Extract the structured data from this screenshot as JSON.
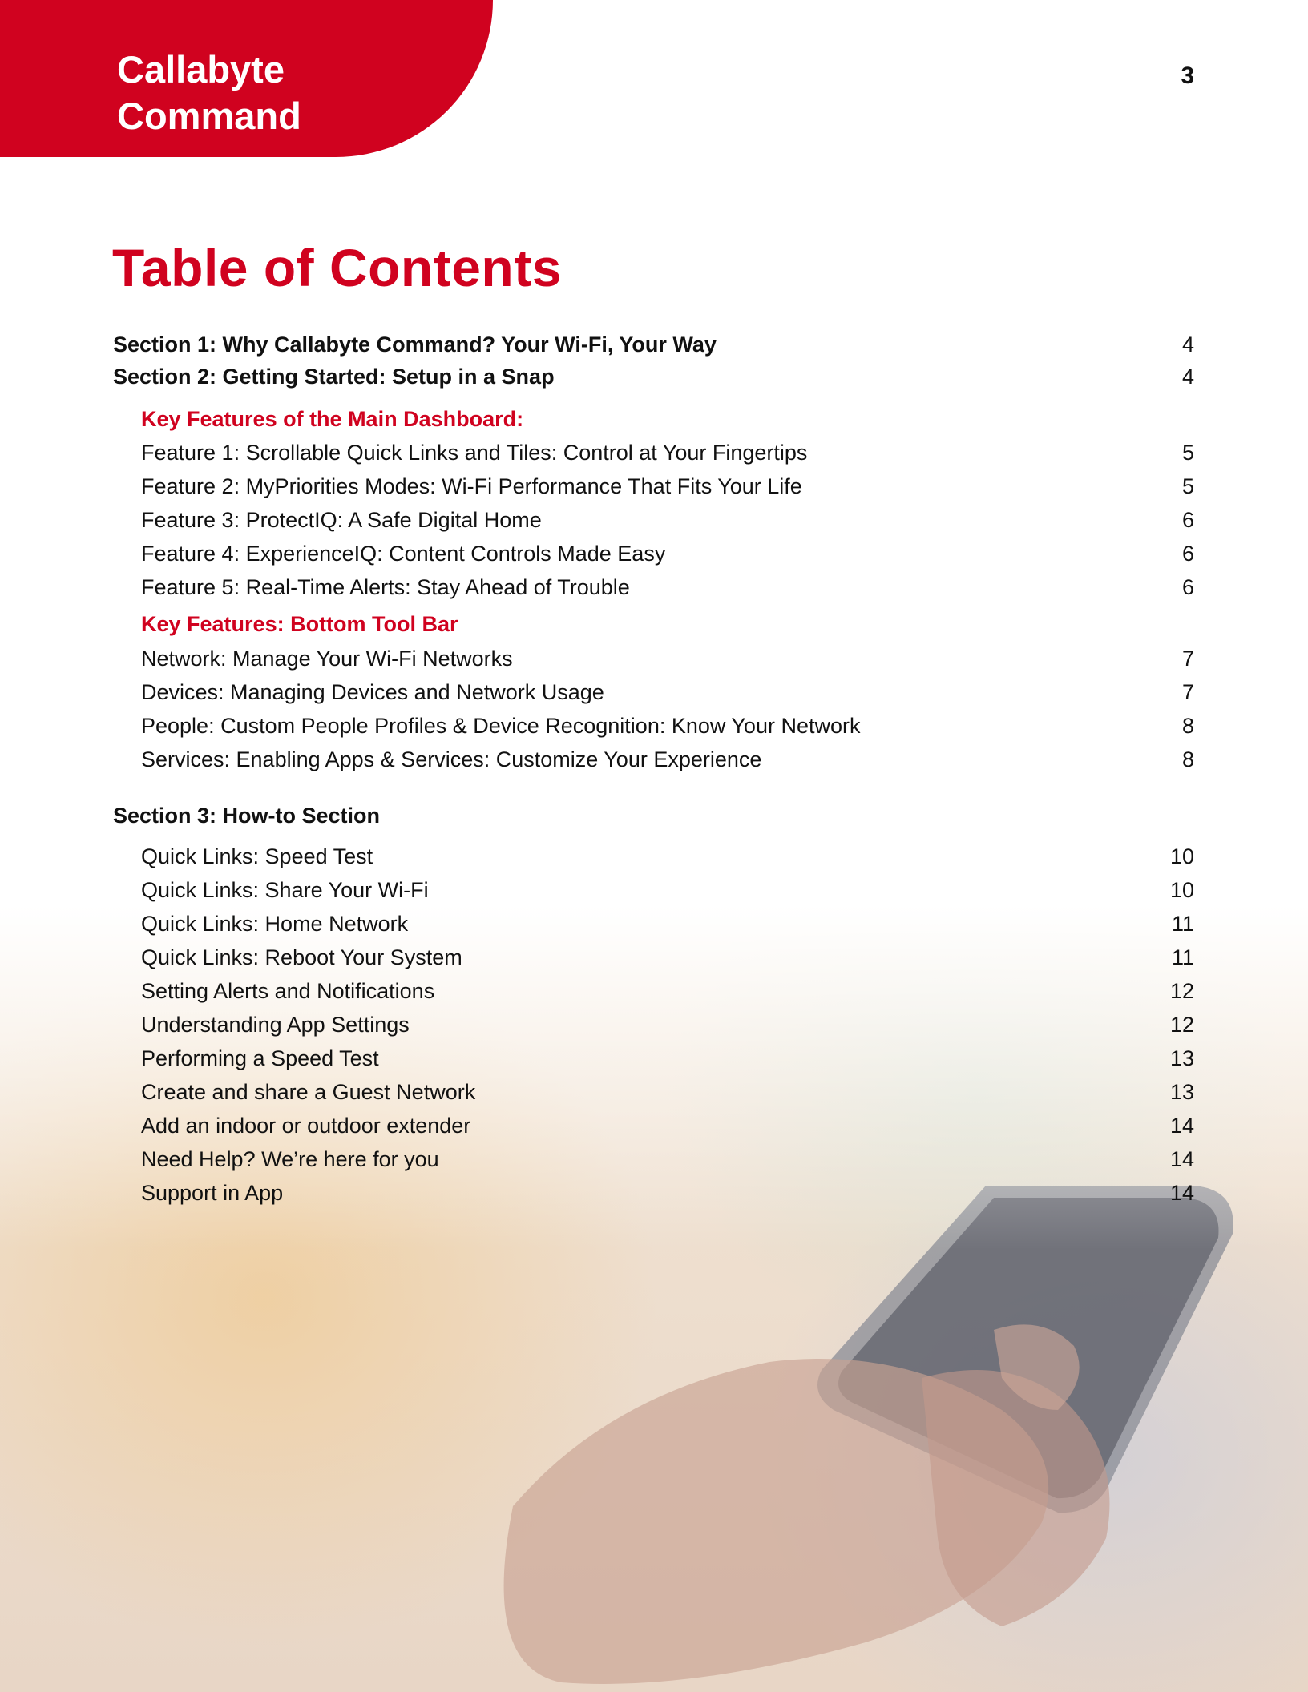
{
  "header": {
    "brand_name": "Callabyte\nCommand",
    "page_number": "3"
  },
  "title": "Table of Contents",
  "colors": {
    "accent": "#d0021f"
  },
  "toc": [
    {
      "kind": "section",
      "label": "Section 1: Why Callabyte Command? Your Wi-Fi, Your Way",
      "page": "4"
    },
    {
      "kind": "section",
      "label": "Section 2: Getting Started: Setup in a Snap",
      "page": "4"
    },
    {
      "kind": "sub",
      "label": "Key Features of the Main Dashboard:",
      "page": ""
    },
    {
      "kind": "item",
      "label": "Feature 1: Scrollable Quick Links and Tiles: Control at Your Fingertips",
      "page": "5"
    },
    {
      "kind": "item",
      "label": "Feature 2: MyPriorities Modes: Wi-Fi Performance That Fits Your Life",
      "page": "5"
    },
    {
      "kind": "item",
      "label": "Feature 3: ProtectIQ: A Safe Digital Home",
      "page": "6"
    },
    {
      "kind": "item",
      "label": "Feature 4: ExperienceIQ: Content Controls Made Easy",
      "page": "6"
    },
    {
      "kind": "item",
      "label": "Feature 5: Real-Time Alerts: Stay Ahead of Trouble",
      "page": "6"
    },
    {
      "kind": "sub",
      "label": "Key Features: Bottom Tool Bar",
      "page": ""
    },
    {
      "kind": "item",
      "label": "Network: Manage Your Wi-Fi Networks",
      "page": "7"
    },
    {
      "kind": "item",
      "label": "Devices: Managing Devices and Network Usage",
      "page": "7"
    },
    {
      "kind": "item",
      "label": "People: Custom People Profiles & Device Recognition: Know Your Network",
      "page": "8"
    },
    {
      "kind": "item",
      "label": "Services: Enabling Apps & Services: Customize Your Experience",
      "page": "8"
    },
    {
      "kind": "section",
      "label": "Section 3: How-to Section",
      "page": ""
    },
    {
      "kind": "item",
      "label": "Quick Links: Speed Test",
      "page": "10"
    },
    {
      "kind": "item",
      "label": "Quick Links: Share Your Wi-Fi",
      "page": "10"
    },
    {
      "kind": "item",
      "label": "Quick Links: Home Network",
      "page": "11"
    },
    {
      "kind": "item",
      "label": "Quick Links: Reboot Your System",
      "page": "11"
    },
    {
      "kind": "item",
      "label": "Setting Alerts and Notifications",
      "page": "12"
    },
    {
      "kind": "item",
      "label": "Understanding App Settings",
      "page": "12"
    },
    {
      "kind": "item",
      "label": "Performing a Speed Test",
      "page": "13"
    },
    {
      "kind": "item",
      "label": "Create and share a Guest Network",
      "page": "13"
    },
    {
      "kind": "item",
      "label": "Add an indoor or outdoor extender",
      "page": "14"
    },
    {
      "kind": "item",
      "label": "Need Help? We’re here for you",
      "page": "14"
    },
    {
      "kind": "item",
      "label": "Support in App",
      "page": "14"
    }
  ]
}
